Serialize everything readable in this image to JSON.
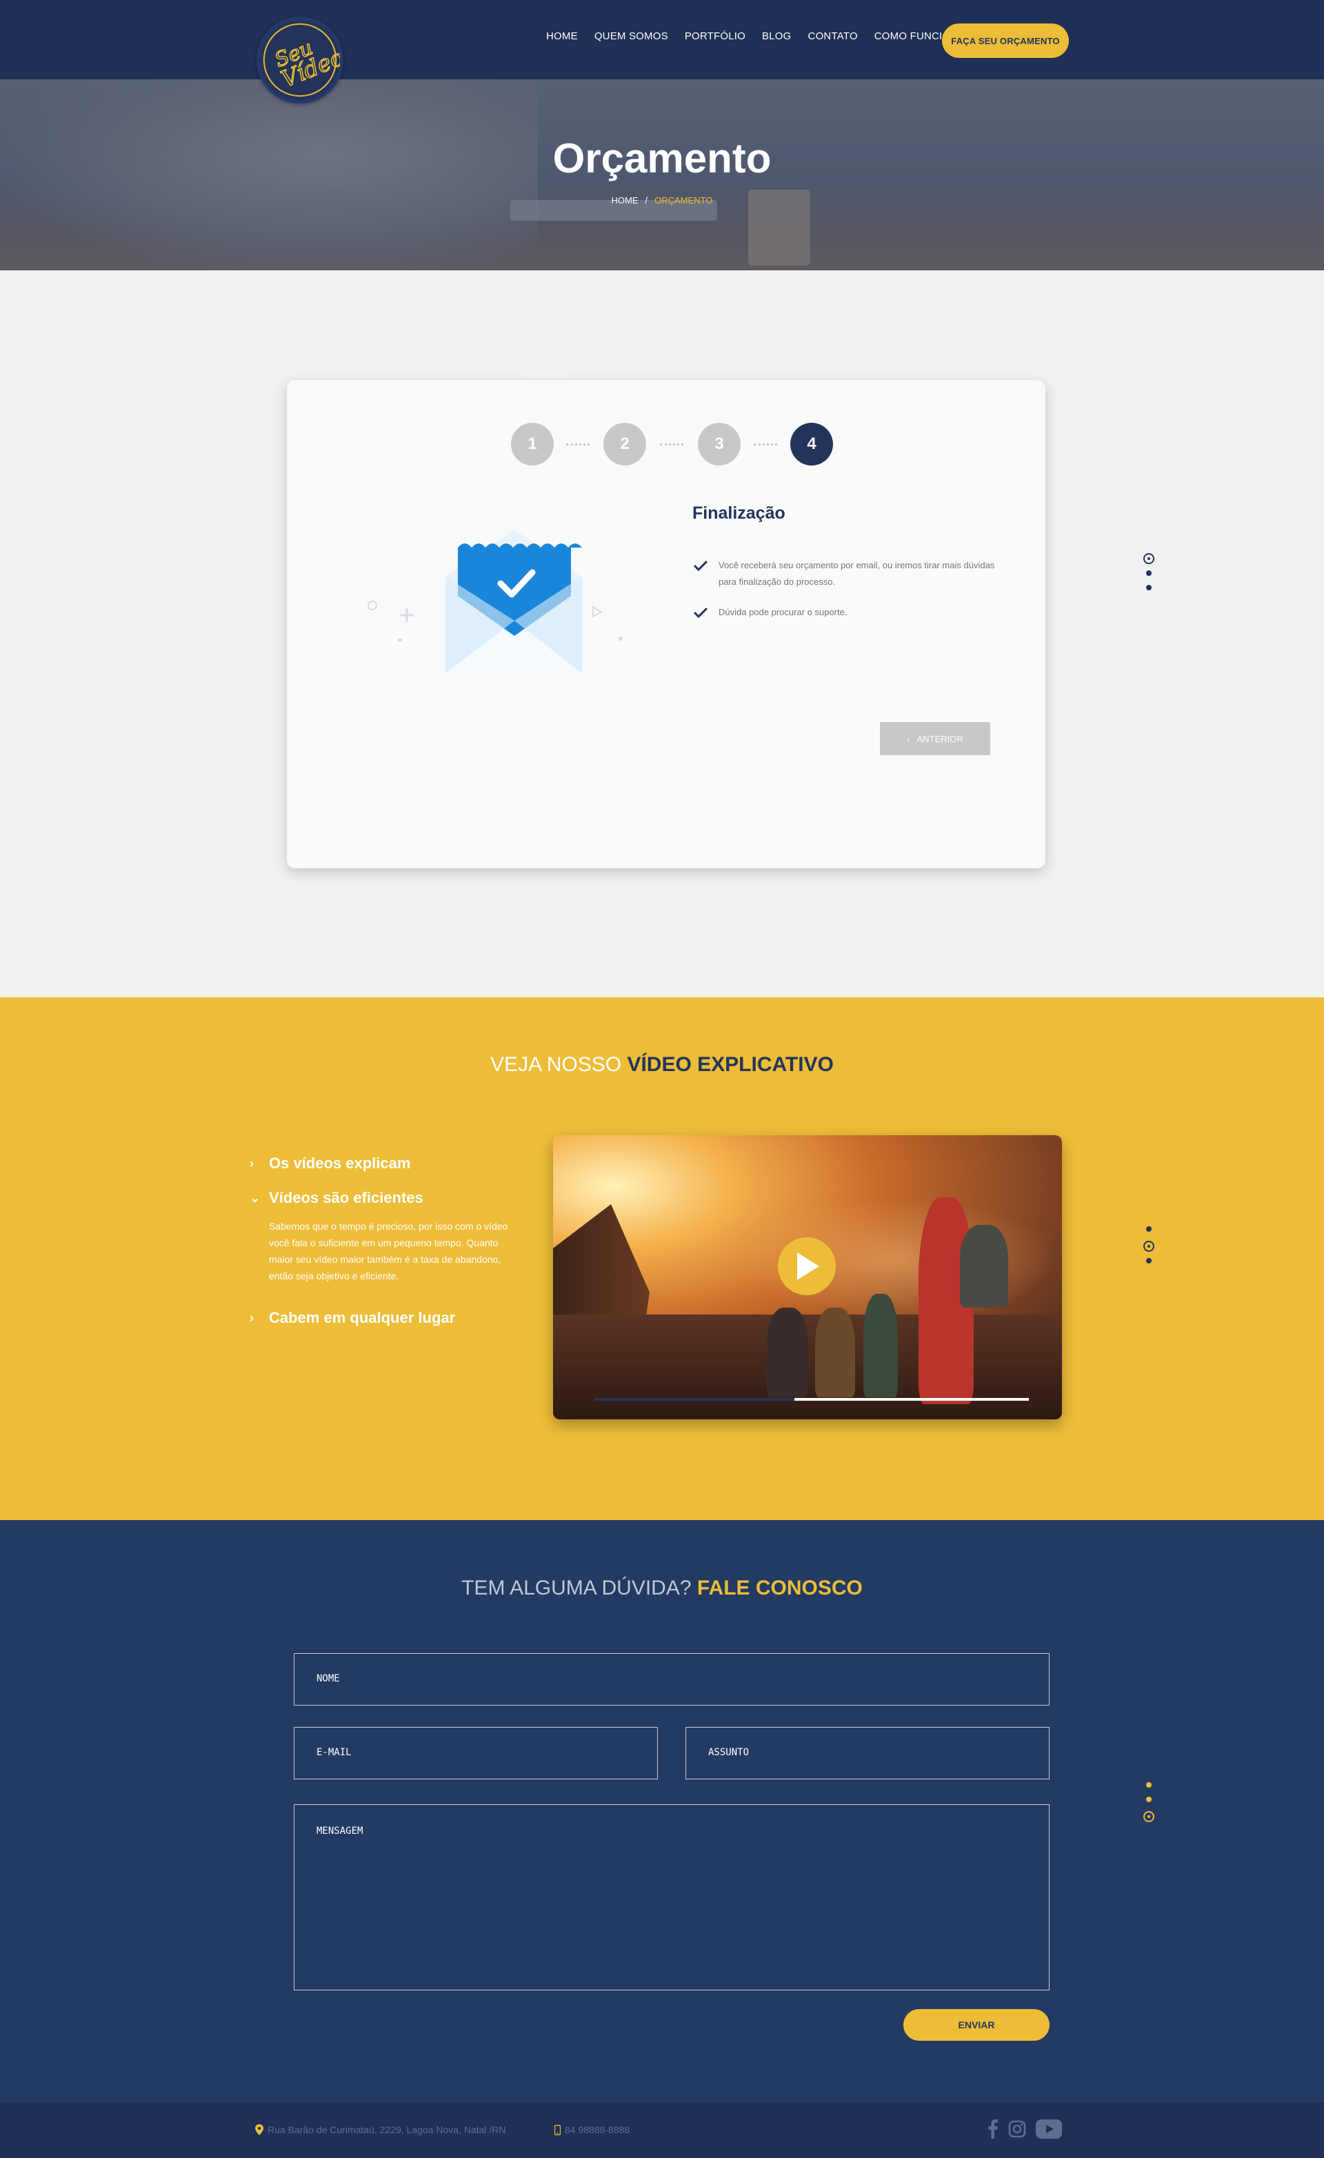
{
  "header": {
    "logo_text": "Seu Video",
    "nav": [
      "HOME",
      "QUEM SOMOS",
      "PORTFÓLIO",
      "BLOG",
      "CONTATO",
      "COMO FUNCIONA"
    ],
    "cta": "FAÇA SEU ORÇAMENTO"
  },
  "hero": {
    "title": "Orçamento",
    "breadcrumb": {
      "home": "HOME",
      "sep": "/",
      "current": "ORÇAMENTO"
    }
  },
  "steps": {
    "numbers": [
      "1",
      "2",
      "3",
      "4"
    ],
    "active_step": 4,
    "title": "Finalização",
    "items": [
      "Você receberá seu orçamento por email, ou iremos tirar mais dúvidas para finalização do processo.",
      "Dúvida pode procurar o suporte."
    ],
    "prev_button": "ANTERIOR",
    "illustration_icon": "mail-checked-icon"
  },
  "video": {
    "title_light": "VEJA NOSSO ",
    "title_bold": "VÍDEO EXPLICATIVO",
    "accordion": [
      {
        "label": "Os vídeos explicam",
        "open": false
      },
      {
        "label": "Vídeos são eficientes",
        "open": true
      },
      {
        "label": "Cabem em qualquer lugar",
        "open": false
      }
    ],
    "open_text": "Sabemos que o tempo é precioso, por isso com o vídeo você fala o suficiente em um pequeno tempo. Quanto maior seu vídeo maior também é a taxa de abandono, então seja objetivo e eficiente.",
    "progress": 0.46
  },
  "contact": {
    "title_light": "TEM ALGUMA DÚVIDA? ",
    "title_bold": "FALE CONOSCO",
    "fields": {
      "name": "NOME",
      "email": "E-MAIL",
      "subject": "ASSUNTO",
      "message": "MENSAGEM"
    },
    "submit": "ENVIAR"
  },
  "footer": {
    "address": "Rua Barão de Curimataú, 2229, Lagoa Nova, Natal /RN",
    "phone": "84 98888-8888",
    "social": [
      "facebook-icon",
      "instagram-icon",
      "youtube-icon"
    ]
  },
  "colors": {
    "navy": "#23345a",
    "yellow": "#edbd38",
    "gray": "#c7c8ca"
  }
}
